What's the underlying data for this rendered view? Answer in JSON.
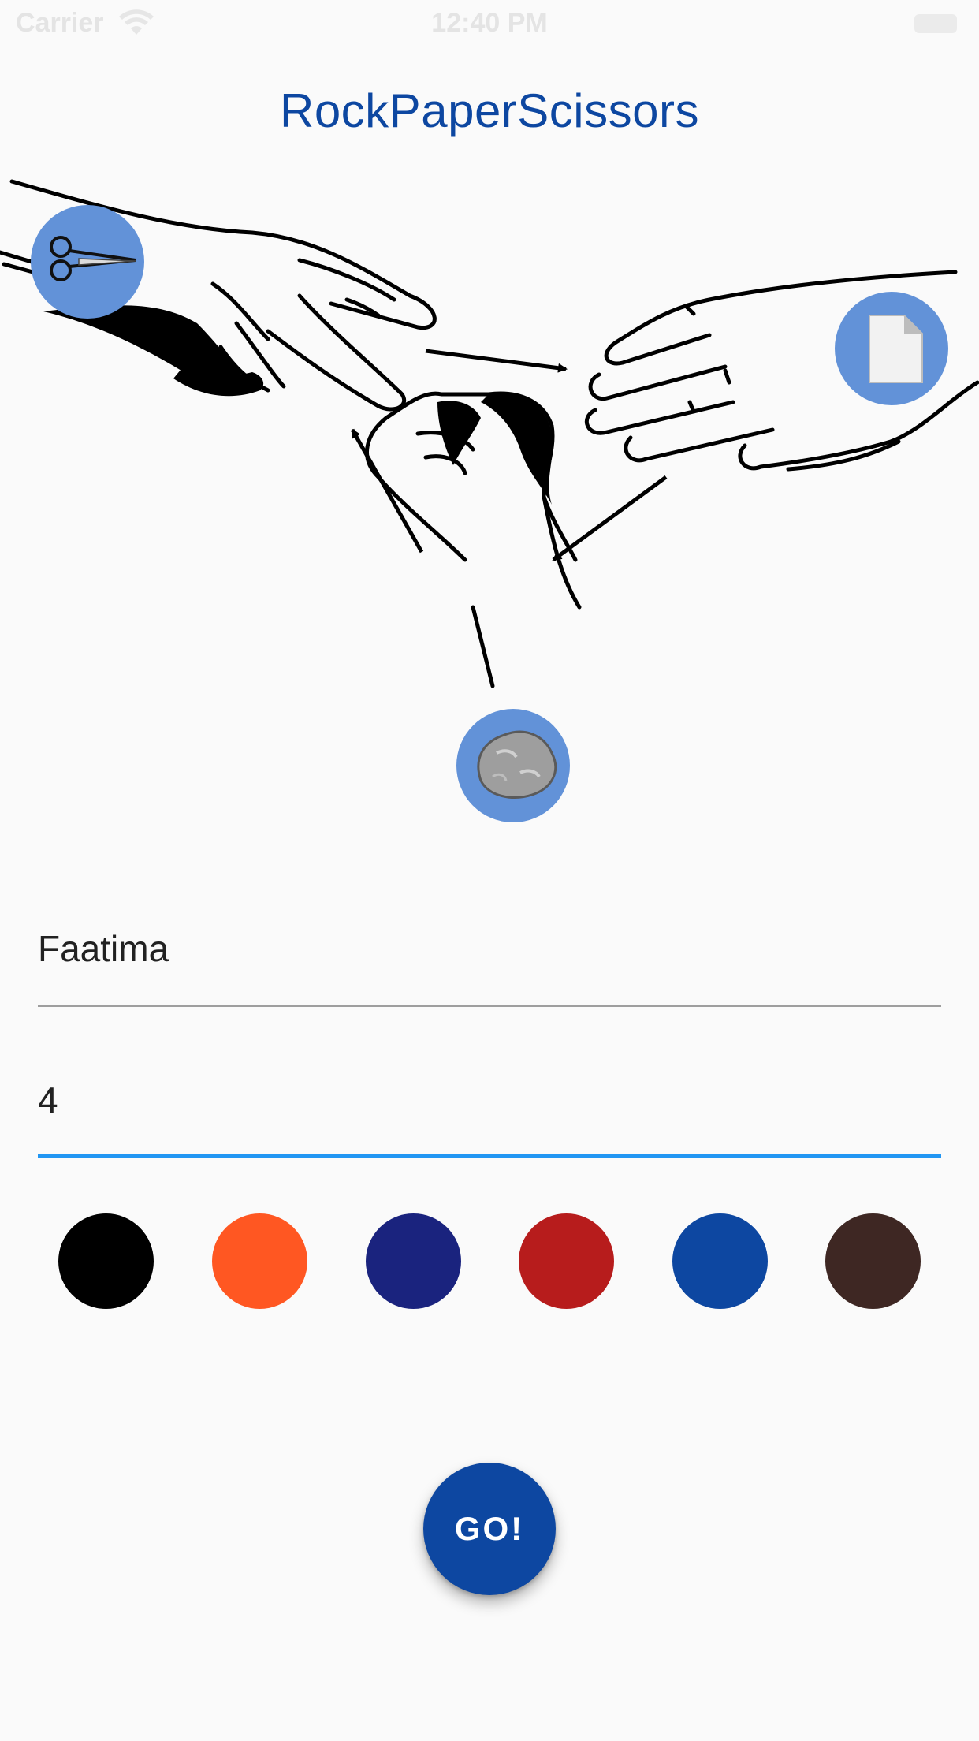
{
  "status_bar": {
    "carrier": "Carrier",
    "time": "12:40 PM",
    "wifi_icon": "wifi-icon",
    "battery_icon": "battery-icon"
  },
  "app": {
    "title": "RockPaperScissors",
    "title_color": "#0d47a1"
  },
  "illustration": {
    "items": [
      {
        "name": "scissors",
        "icon": "scissors-icon"
      },
      {
        "name": "paper",
        "icon": "paper-icon"
      },
      {
        "name": "rock",
        "icon": "rock-icon"
      }
    ],
    "badge_color": "#6292d8"
  },
  "form": {
    "name_value": "Faatima",
    "score_value": "4",
    "focused_underline_color": "#2196f3"
  },
  "colors": [
    "#000000",
    "#ff5722",
    "#1a237e",
    "#b71c1c",
    "#0d47a1",
    "#3e2723"
  ],
  "go_button": {
    "label": "GO!",
    "color": "#0d47a1"
  }
}
